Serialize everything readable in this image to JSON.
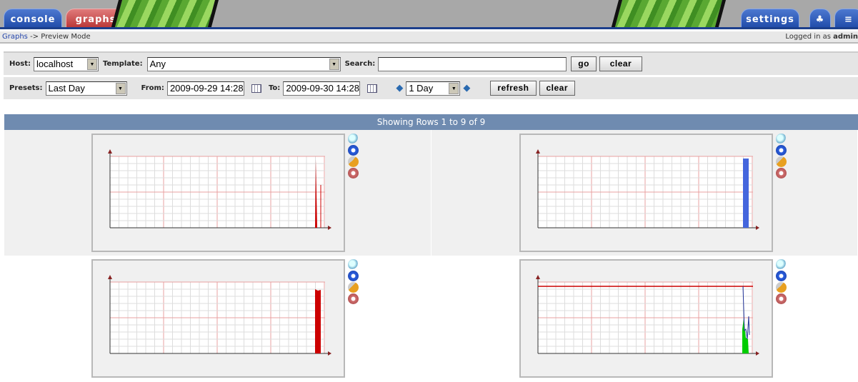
{
  "header": {
    "tabs": [
      {
        "label": "console"
      },
      {
        "label": "graphs"
      },
      {
        "label": "settings"
      }
    ],
    "tree_icon": "tree-icon",
    "list_icon": "list-icon"
  },
  "breadcrumb": {
    "link": "Graphs",
    "rest": "-> Preview Mode",
    "login_prefix": "Logged in as",
    "user": "admin"
  },
  "filters": {
    "host_label": "Host:",
    "host": "localhost",
    "template_label": "Template:",
    "template": "Any",
    "search_label": "Search:",
    "search_value": "",
    "go": "go",
    "clear": "clear",
    "presets_label": "Presets:",
    "preset": "Last Day",
    "from_label": "From:",
    "from": "2009-09-29 14:28",
    "to_label": "To:",
    "to": "2009-09-30 14:28",
    "timespan": "1 Day",
    "refresh": "refresh",
    "clear2": "clear"
  },
  "table": {
    "header": "Showing Rows 1 to 9 of 9"
  },
  "colors": {
    "accent": "#6f8bb0",
    "graph_red": "#cc0000",
    "graph_blue": "#4466dd",
    "graph_green": "#00cc00"
  },
  "graphs": [
    {
      "series": "red spike"
    },
    {
      "series": "blue area"
    },
    {
      "series": "red area"
    },
    {
      "series": "green area, blue line, red line"
    }
  ]
}
